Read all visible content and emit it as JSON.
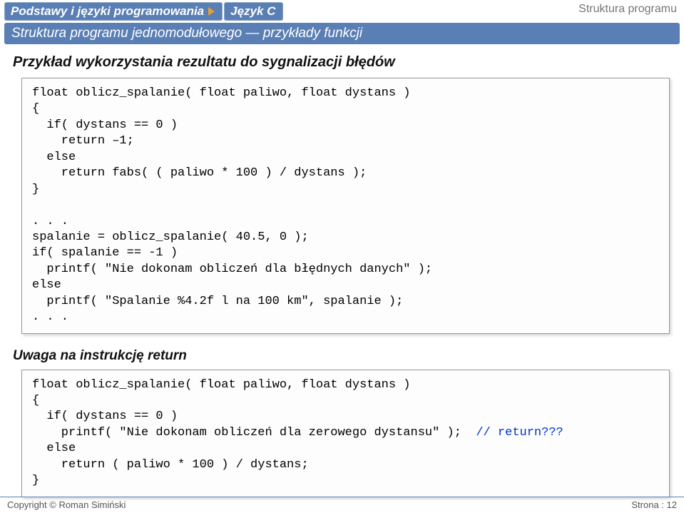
{
  "header": {
    "breadcrumb1": "Podstawy i języki programowania",
    "breadcrumb2": "Język C",
    "right": "Struktura programu"
  },
  "subtitle": "Struktura programu jednomodułowego — przykłady funkcji",
  "section_title": "Przykład wykorzystania rezultatu do sygnalizacji błędów",
  "code1": "float oblicz_spalanie( float paliwo, float dystans )\n{\n  if( dystans == 0 )\n    return –1;\n  else\n    return fabs( ( paliwo * 100 ) / dystans );\n}\n\n. . .\nspalanie = oblicz_spalanie( 40.5, 0 );\nif( spalanie == -1 )\n  printf( \"Nie dokonam obliczeń dla błędnych danych\" );\nelse\n  printf( \"Spalanie %4.2f l na 100 km\", spalanie );\n. . .",
  "section2_title": "Uwaga na instrukcję return",
  "code2_pre": "float oblicz_spalanie( float paliwo, float dystans )\n{\n  if( dystans == 0 )\n    printf( \"Nie dokonam obliczeń dla zerowego dystansu\" );  ",
  "code2_comment": "// return???",
  "code2_post": "\n  else\n    return ( paliwo * 100 ) / dystans;\n}",
  "footer": {
    "copyright": "Copyright © Roman Simiński",
    "page": "Strona : 12"
  }
}
